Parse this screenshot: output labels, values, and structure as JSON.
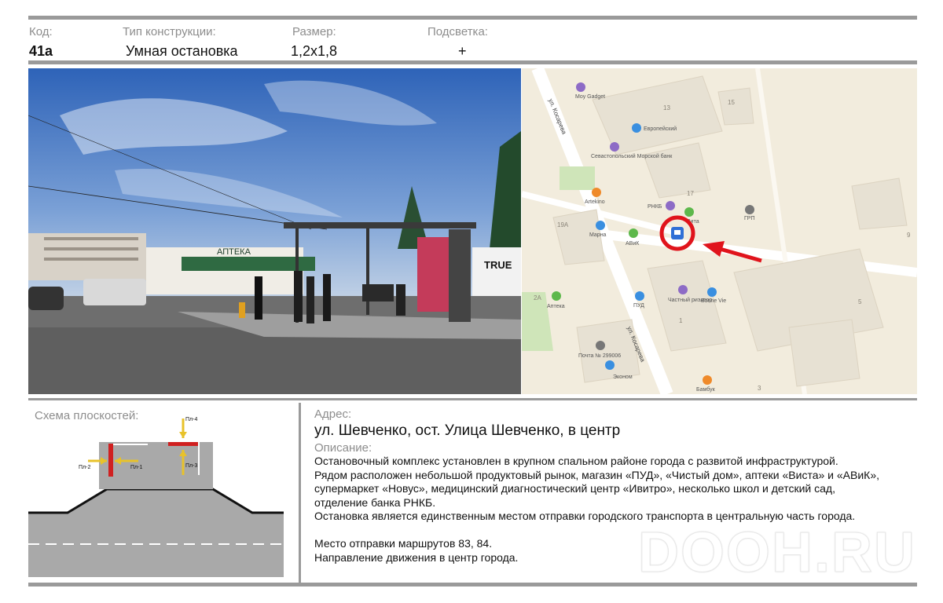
{
  "header": {
    "code_label": "Код:",
    "code_value": "41а",
    "type_label": "Тип конструкции:",
    "type_value": "Умная остановка",
    "size_label": "Размер:",
    "size_value": "1,2х1,8",
    "light_label": "Подсветка:",
    "light_value": "+"
  },
  "photo": {
    "pharmacy_sign": "АПТЕКА",
    "truck_sign": "TRUE"
  },
  "map": {
    "street_top": "ул. Косарева",
    "street_bottom": "ул. Косарева",
    "places": [
      {
        "name": "Moy Gadget",
        "color": "#8d6bc6"
      },
      {
        "name": "Европейский",
        "color": "#3a8fe0"
      },
      {
        "name": "Севастопольский Морской банк",
        "color": "#8d6bc6"
      },
      {
        "name": "Аrtekino",
        "color": "#ef8a2a"
      },
      {
        "name": "РНКБ",
        "color": "#8d6bc6"
      },
      {
        "name": "Вита",
        "color": "#5db84b"
      },
      {
        "name": "ГРП",
        "color": "#777777"
      },
      {
        "name": "Марна",
        "color": "#3a8fe0"
      },
      {
        "name": "АВиК",
        "color": "#5db84b"
      },
      {
        "name": "Аптека",
        "color": "#5db84b"
      },
      {
        "name": "ПУД",
        "color": "#3a8fe0"
      },
      {
        "name": "Частный риэлтор",
        "color": "#8d6bc6"
      },
      {
        "name": "Bonne Vie",
        "color": "#3a8fe0"
      },
      {
        "name": "Почта № 299006",
        "color": "#777777"
      },
      {
        "name": "Эконом",
        "color": "#3a8fe0"
      },
      {
        "name": "Бамбук",
        "color": "#ef8a2a"
      }
    ],
    "house_numbers": [
      "13",
      "15",
      "17",
      "19А",
      "2А",
      "1",
      "5",
      "3",
      "9"
    ],
    "accent_colors": {
      "marker": "#e0141c",
      "stop_icon": "#2f6fd6"
    }
  },
  "schema": {
    "title": "Схема плоскостей:",
    "planes": [
      "Пл-1",
      "Пл-2",
      "Пл-3",
      "Пл-4"
    ],
    "colors": {
      "plane": "#d02020",
      "arrow": "#e8c22a",
      "road": "#a9a9a9"
    }
  },
  "address": {
    "label": "Адрес:",
    "value": "ул. Шевченко, ост. Улица Шевченко, в центр"
  },
  "description": {
    "label": "Описание:",
    "lines": [
      "Остановочный комплекс установлен в крупном спальном районе города с развитой инфраструктурой.",
      "Рядом расположен небольшой продуктовый рынок, магазин «ПУД», «Чистый дом», аптеки «Виста» и «АВиК»,",
      "супермаркет «Новус», медицинский диагностический центр «Ивитро», несколько школ и детский сад,",
      "отделение банка РНКБ.",
      "Остановка является единственным местом отправки городского транспорта в центральную часть города."
    ],
    "routes": "Место отправки маршрутов  83, 84.",
    "direction": "Направление движения в центр города."
  },
  "watermark": "DOOH.RU"
}
